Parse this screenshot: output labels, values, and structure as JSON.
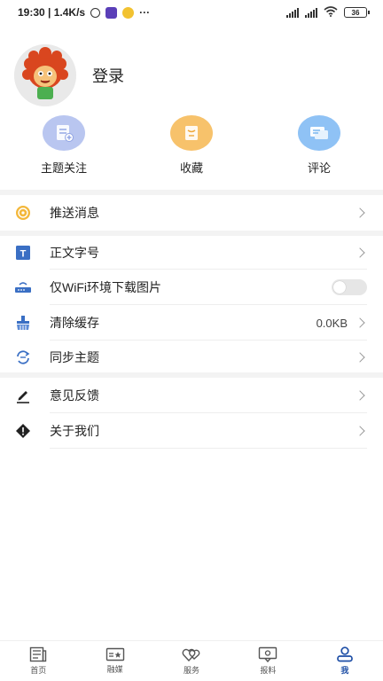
{
  "status_bar": {
    "time_speed": "19:30 | 1.4K/s",
    "dots": "···",
    "battery": "36"
  },
  "profile": {
    "login_label": "登录"
  },
  "quick_actions": [
    {
      "label": "主题关注",
      "color": "#b9c6f0",
      "icon": "document-add-icon"
    },
    {
      "label": "收藏",
      "color": "#f7c26b",
      "icon": "bookmark-icon"
    },
    {
      "label": "评论",
      "color": "#8fc2f5",
      "icon": "comment-icon"
    }
  ],
  "settings": {
    "push": {
      "label": "推送消息"
    },
    "font_size": {
      "label": "正文字号"
    },
    "wifi_images": {
      "label": "仅WiFi环境下载图片"
    },
    "clear_cache": {
      "label": "清除缓存",
      "value": "0.0KB"
    },
    "sync_topics": {
      "label": "同步主题"
    },
    "feedback": {
      "label": "意见反馈"
    },
    "about": {
      "label": "关于我们"
    }
  },
  "bottom_nav": {
    "items": [
      {
        "label": "首页"
      },
      {
        "label": "融媒"
      },
      {
        "label": "服务"
      },
      {
        "label": "报料"
      },
      {
        "label": "我"
      }
    ],
    "active_color": "#1e4fa6"
  }
}
